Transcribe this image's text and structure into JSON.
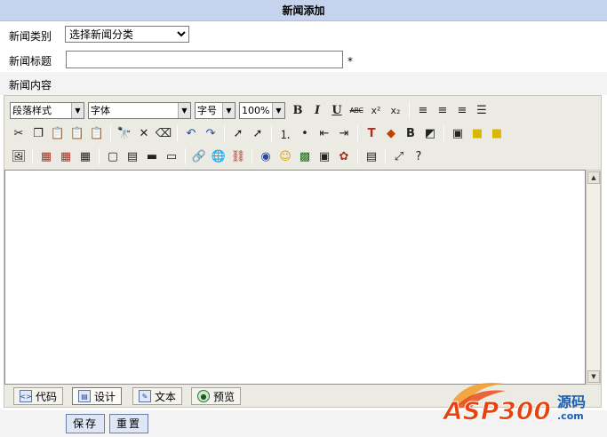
{
  "header": {
    "title": "新闻添加"
  },
  "form": {
    "category_label": "新闻类别",
    "category_value": "选择新闻分类",
    "title_label": "新闻标题",
    "title_value": "",
    "required_mark": "*",
    "content_label": "新闻内容"
  },
  "editor": {
    "paragraph_style": "段落样式",
    "font": "字体",
    "font_size": "字号",
    "zoom": "100%",
    "modes": [
      "代码",
      "设计",
      "文本",
      "预览"
    ],
    "active_mode": "设计"
  },
  "buttons": {
    "save": "保存",
    "reset": "重置"
  },
  "logo": {
    "text": "ASP300",
    "suffix": "源码",
    "domain": ".com",
    "brand_color": "#e8430f",
    "accent_color": "#1a5fb4"
  }
}
